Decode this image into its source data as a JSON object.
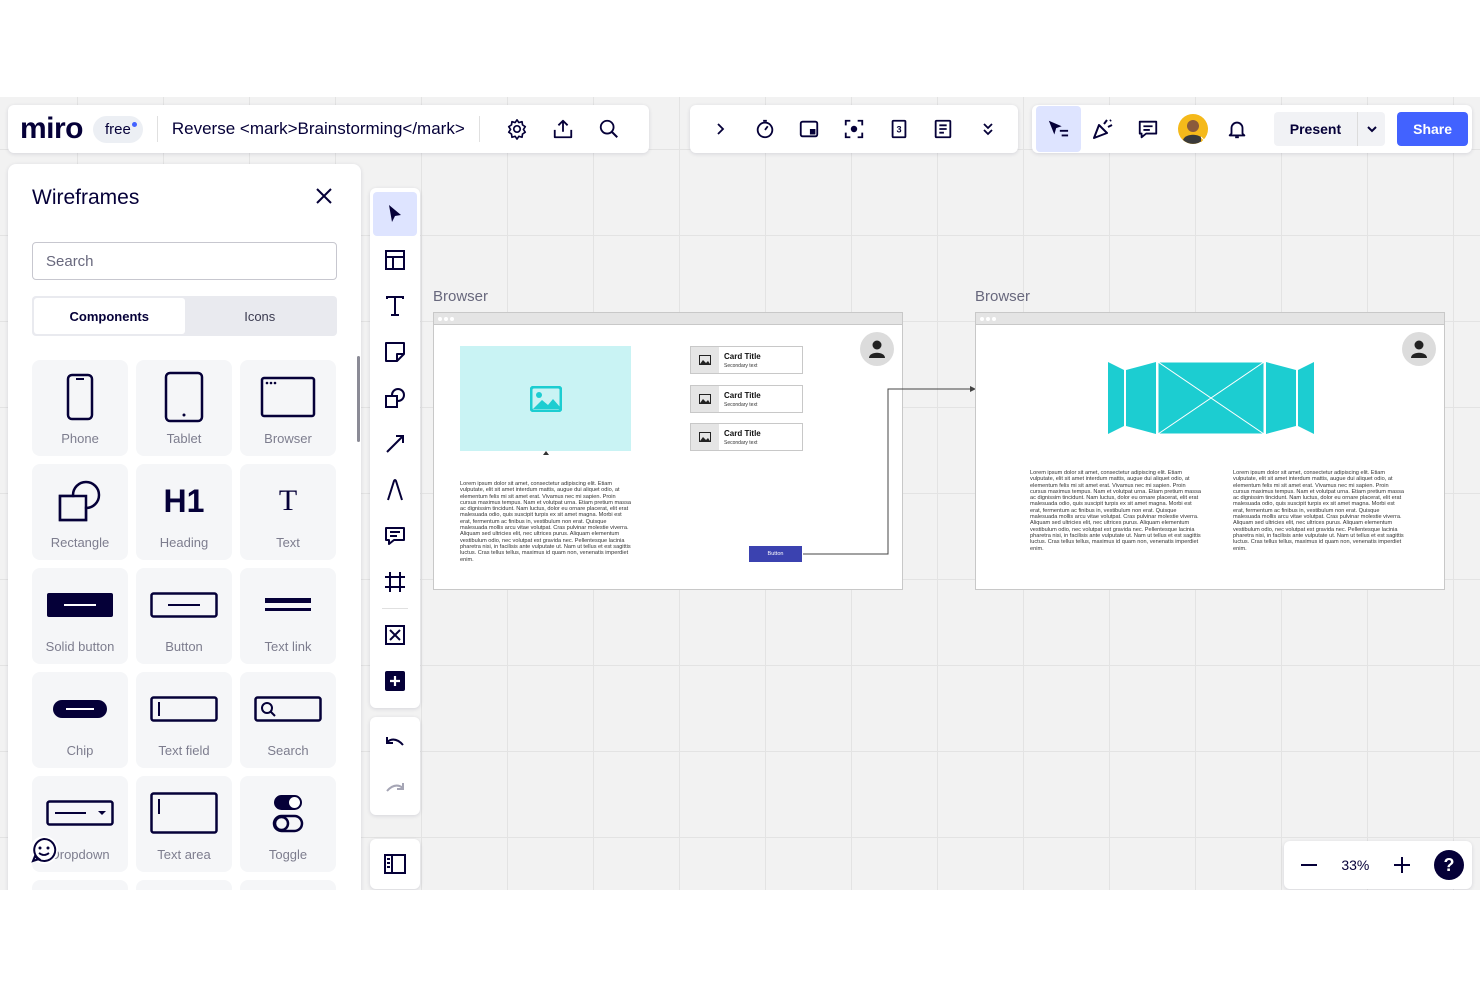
{
  "header": {
    "logo": "miro",
    "plan_badge": "free",
    "board_title": "Reverse <mark>Brainstorming</mark>",
    "present_label": "Present",
    "share_label": "Share"
  },
  "icons": {
    "top_left": [
      "settings-icon",
      "upload-icon",
      "search-icon"
    ],
    "top_middle": [
      "chevron-right-icon",
      "timer-icon",
      "sticky-add-icon",
      "focus-icon",
      "card-count-icon",
      "notes-icon",
      "chevron-double-down-icon"
    ],
    "top_right": [
      "cursor-mode-icon",
      "celebrate-icon",
      "comments-icon",
      "user-avatar",
      "bell-icon"
    ]
  },
  "sidebar": {
    "title": "Wireframes",
    "search_placeholder": "Search",
    "tabs": [
      {
        "label": "Components",
        "active": true
      },
      {
        "label": "Icons",
        "active": false
      }
    ],
    "items": [
      {
        "label": "Phone",
        "icon": "phone-icon"
      },
      {
        "label": "Tablet",
        "icon": "tablet-icon"
      },
      {
        "label": "Browser",
        "icon": "browser-icon"
      },
      {
        "label": "Rectangle",
        "icon": "rectangle-icon"
      },
      {
        "label": "Heading",
        "icon": "heading-icon"
      },
      {
        "label": "Text",
        "icon": "text-icon"
      },
      {
        "label": "Solid button",
        "icon": "solid-button-icon"
      },
      {
        "label": "Button",
        "icon": "button-icon"
      },
      {
        "label": "Text link",
        "icon": "text-link-icon"
      },
      {
        "label": "Chip",
        "icon": "chip-icon"
      },
      {
        "label": "Text field",
        "icon": "text-field-icon"
      },
      {
        "label": "Search",
        "icon": "search-field-icon"
      },
      {
        "label": "Dropdown",
        "icon": "dropdown-icon"
      },
      {
        "label": "Text area",
        "icon": "text-area-icon"
      },
      {
        "label": "Toggle",
        "icon": "toggle-icon"
      }
    ],
    "heading_glyph": "H1",
    "text_glyph": "T"
  },
  "toolbar": {
    "tools": [
      "select-tool-icon",
      "templates-icon",
      "text-tool-icon",
      "sticky-note-icon",
      "shapes-icon",
      "connector-icon",
      "pen-icon",
      "comment-icon",
      "frame-icon",
      "wireframe-icon",
      "add-more-icon"
    ],
    "history": [
      "undo-icon",
      "redo-icon"
    ]
  },
  "zoom": {
    "level": "33%",
    "help": "?"
  },
  "canvas": {
    "frames": [
      {
        "label": "Browser",
        "cards": [
          {
            "title": "Card Title",
            "subtitle": "Secondary text"
          },
          {
            "title": "Card Title",
            "subtitle": "Secondary text"
          },
          {
            "title": "Card Title",
            "subtitle": "Secondary text"
          }
        ],
        "lorem": "Lorem ipsum dolor sit amet, consectetur adipiscing elit. Etiam vulputate, elit sit amet interdum mattis, augue dui aliquet odio, at elementum felis mi sit amet erat. Vivamus nec mi sapien. Proin cursus maximus tempus. Nam et volutpat urna. Etiam pretium massa ac dignissim tincidunt. Nam luctus, dolor eu ornare placerat, elit erat malesuada odio, quis suscipit turpis ex sit amet magna. Morbi est erat, fermentum ac finibus in, vestibulum non erat. Quisque malesuada mollis arcu vitae volutpat. Cras pulvinar molestie viverra. Aliquam sed ultricies elit, nec ultrices purus. Aliquam elementum vestibulum odio, nec volutpat est gravida nec. Pellentesque lacinia pharetra nisi, in facilisis ante vulputate ut. Nam ut tellus et est sagittis luctus. Cras tellus tellus, maximus id quam non, venenatis imperdiet enim.",
        "button": "Button"
      },
      {
        "label": "Browser",
        "lorem_left": "Lorem ipsum dolor sit amet, consectetur adipiscing elit. Etiam vulputate, elit sit amet interdum mattis, augue dui aliquet odio, at elementum felis mi sit amet erat. Vivamus nec mi sapien. Proin cursus maximus tempus. Nam et volutpat urna. Etiam pretium massa ac dignissim tincidunt. Nam luctus, dolor eu ornare placerat, elit erat malesuada odio, quis suscipit turpis ex sit amet magna. Morbi est erat, fermentum ac finibus in, vestibulum non erat. Quisque malesuada mollis arcu vitae volutpat. Cras pulvinar molestie viverra. Aliquam sed ultricies elit, nec ultrices purus. Aliquam elementum vestibulum odio, nec volutpat est gravida nec. Pellentesque lacinia pharetra nisi, in facilisis ante vulputate ut. Nam ut tellus et est sagittis luctus. Cras tellus tellus, maximus id quam non, venenatis imperdiet enim.",
        "lorem_right": "Lorem ipsum dolor sit amet, consectetur adipiscing elit. Etiam vulputate, elit sit amet interdum mattis, augue dui aliquet odio, at elementum felis mi sit amet erat. Vivamus nec mi sapien. Proin cursus maximus tempus. Nam et volutpat urna. Etiam pretium massa ac dignissim tincidunt. Nam luctus, dolor eu ornare placerat, elit erat malesuada odio, quis suscipit turpis ex sit amet magna. Morbi est erat, fermentum ac finibus in, vestibulum non erat. Quisque malesuada mollis arcu vitae volutpat. Cras pulvinar molestie viverra. Aliquam sed ultricies elit, nec ultrices purus. Aliquam elementum vestibulum odio, nec volutpat est gravida nec. Pellentesque lacinia pharetra nisi, in facilisis ante vulputate ut. Nam ut tellus et est sagittis luctus. Cras tellus tellus, maximus id quam non, venenatis imperdiet enim."
      }
    ]
  },
  "colors": {
    "accent": "#4262ff",
    "ink": "#050038",
    "cyan": "#1ccdd1",
    "image_placeholder": "#c9f3f4",
    "wire_button": "#3b42b0"
  }
}
